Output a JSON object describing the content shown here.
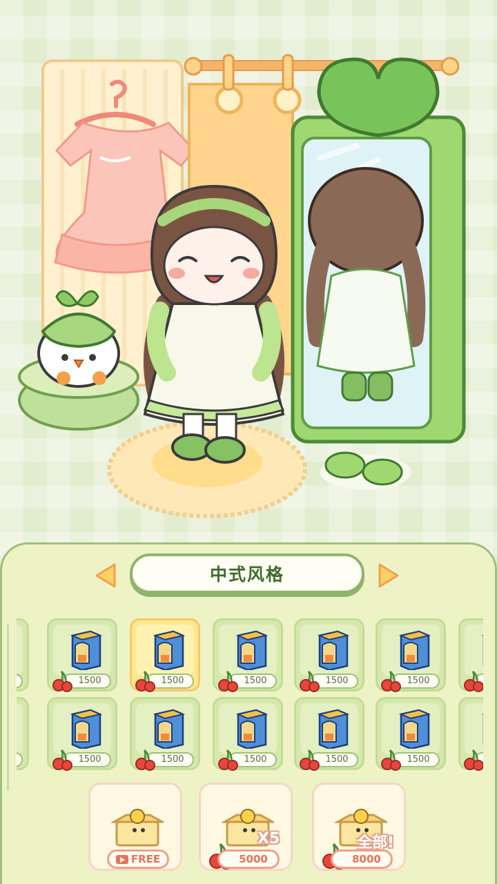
{
  "category": {
    "title": "中式风格"
  },
  "items": {
    "price": "1500",
    "rows": 2,
    "visible_columns": 6,
    "selected_index": 1
  },
  "gacha": {
    "single": {
      "label": "FREE",
      "icon": "video-icon"
    },
    "multi": {
      "tag": "X5",
      "price": "5000"
    },
    "all": {
      "tag": "全部!",
      "price": "8000"
    }
  },
  "colors": {
    "accent": "#8fb56c",
    "panel": "#eef3c5",
    "selected": "#ffe88f",
    "price_red": "#e87258"
  }
}
